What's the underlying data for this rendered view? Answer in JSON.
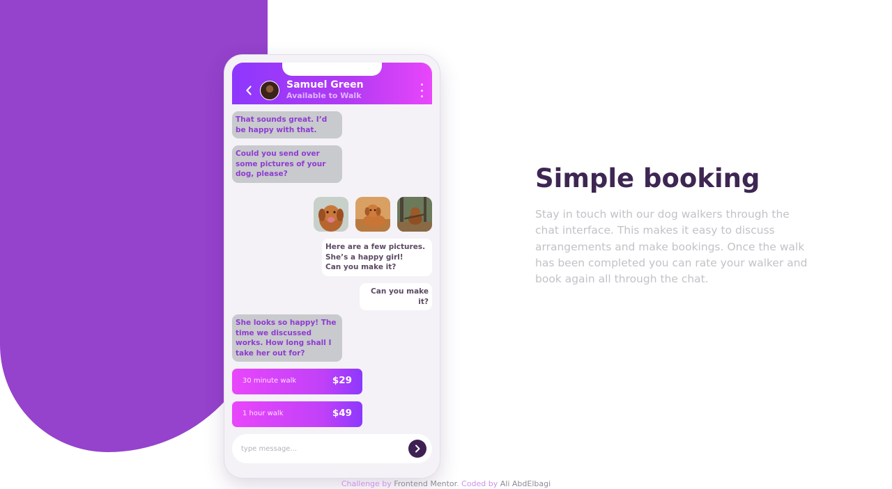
{
  "colors": {
    "primary_purple": "#9542cc",
    "header_gradient_start": "#8d38fd",
    "header_gradient_end": "#e946fb",
    "heading": "#3e2653",
    "body_text": "#c3c1c7",
    "send_button": "#3e2053"
  },
  "chat": {
    "back_icon": "chevron-left-icon",
    "contact_name": "Samuel Green",
    "contact_status": "Available to Walk",
    "menu_icon": "more-vertical-icon",
    "messages": [
      {
        "from": "walker",
        "text": "That sounds great. I’d be happy with that."
      },
      {
        "from": "walker",
        "text": "Could you send over some pictures of your dog, please?"
      },
      {
        "from": "owner",
        "text": "Here are a few pictures. She’s a happy girl!\nCan you make it?"
      },
      {
        "from": "owner",
        "text": "Can you make it?"
      },
      {
        "from": "walker",
        "text": "She looks so happy! The time we discussed works. How long shall I take her out for?"
      }
    ],
    "photos": [
      "dog-photo-1",
      "dog-photo-2",
      "dog-photo-3"
    ],
    "offers": [
      {
        "label": "30 minute walk",
        "price": "$29"
      },
      {
        "label": "1 hour walk",
        "price": "$49"
      }
    ],
    "compose_placeholder": "type message...",
    "send_icon": "chevron-right-icon"
  },
  "content": {
    "heading": "Simple booking",
    "description": "Stay in touch with our dog walkers through the chat interface. This makes it easy to discuss arrangements and make bookings. Once the walk has been completed you can rate your walker and book again all through the chat."
  },
  "attribution": {
    "challenge_prefix": "Challenge by",
    "challenge_link": "Frontend Mentor",
    "separator": ".",
    "coded_prefix": "Coded by",
    "coded_link": "Ali AbdElbagi"
  }
}
